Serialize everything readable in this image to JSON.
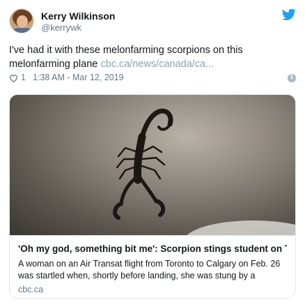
{
  "author": {
    "display_name": "Kerry Wilkinson",
    "handle": "@kerrywk"
  },
  "tweet": {
    "text": "I've had it with these melonfarming scorpions on this melonfarming plane",
    "link": "cbc.ca/news/canada/ca..."
  },
  "meta": {
    "likes": "1",
    "timestamp": "1:38 AM - Mar 12, 2019"
  },
  "card": {
    "title": "'Oh my god, something bit me': Scorpion stings student on To...",
    "description": "A woman on an Air Transat flight from Toronto to Calgary on Feb. 26 was startled when, shortly before landing, she was stung by a",
    "domain": "cbc.ca"
  },
  "icons": {
    "brand": "twitter-bird-icon",
    "like": "heart-icon",
    "info": "info-icon"
  },
  "colors": {
    "twitter_blue": "#1da1f2",
    "link": "#8aa2b5",
    "secondary_text": "#657786",
    "border": "#e1e8ed"
  }
}
